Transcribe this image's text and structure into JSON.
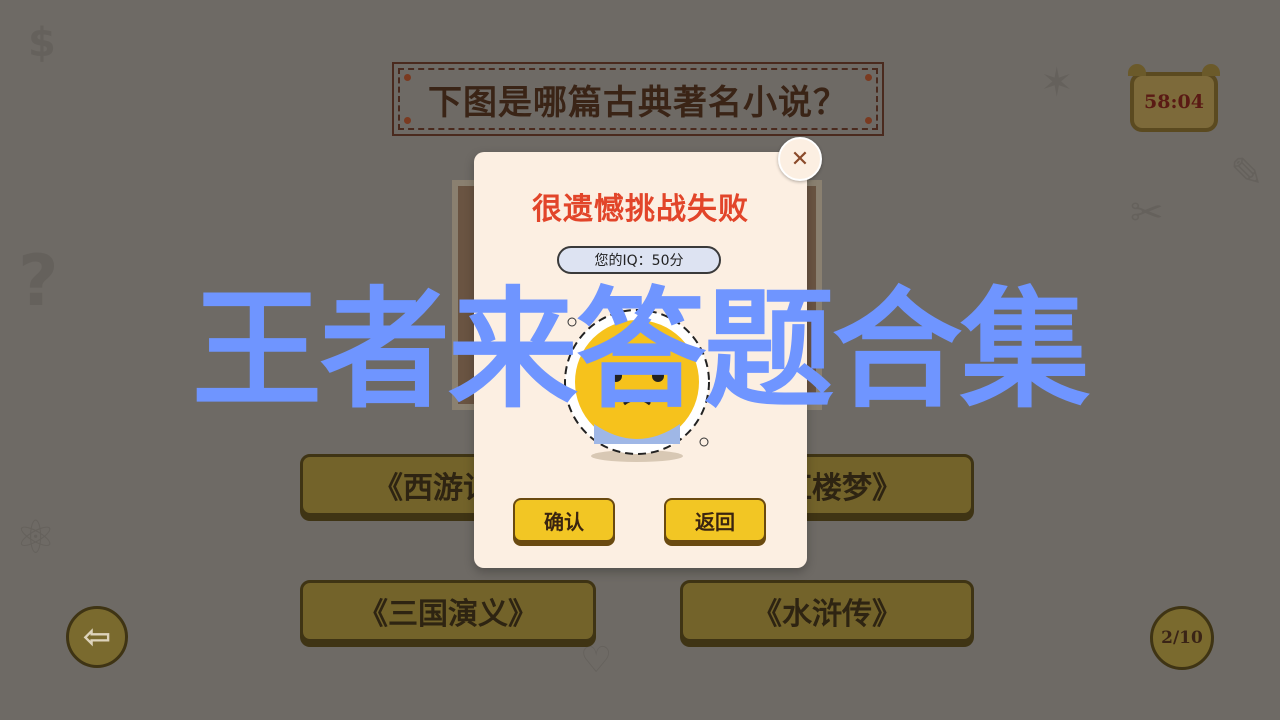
{
  "game": {
    "question": "下图是哪篇古典著名小说？",
    "timer": "58:04",
    "progress": "2/10",
    "answers": [
      "《西游记》",
      "《红楼梦》",
      "《三国演义》",
      "《水浒传》"
    ]
  },
  "modal": {
    "title": "很遗憾挑战失败",
    "iq_text": "您的IQ：50分",
    "confirm_label": "确认",
    "return_label": "返回"
  },
  "icons": {
    "close": "close-icon",
    "back": "back-arrow-icon",
    "timer": "alarm-clock-icon",
    "progress": "lightbulb-icon"
  },
  "watermark": "王者来答题合集",
  "colors": {
    "background": "#6e6a65",
    "modal_bg": "#fcefe2",
    "title_red": "#e2452a",
    "button_yellow": "#f2c624",
    "watermark_blue": "#6f95ff"
  }
}
